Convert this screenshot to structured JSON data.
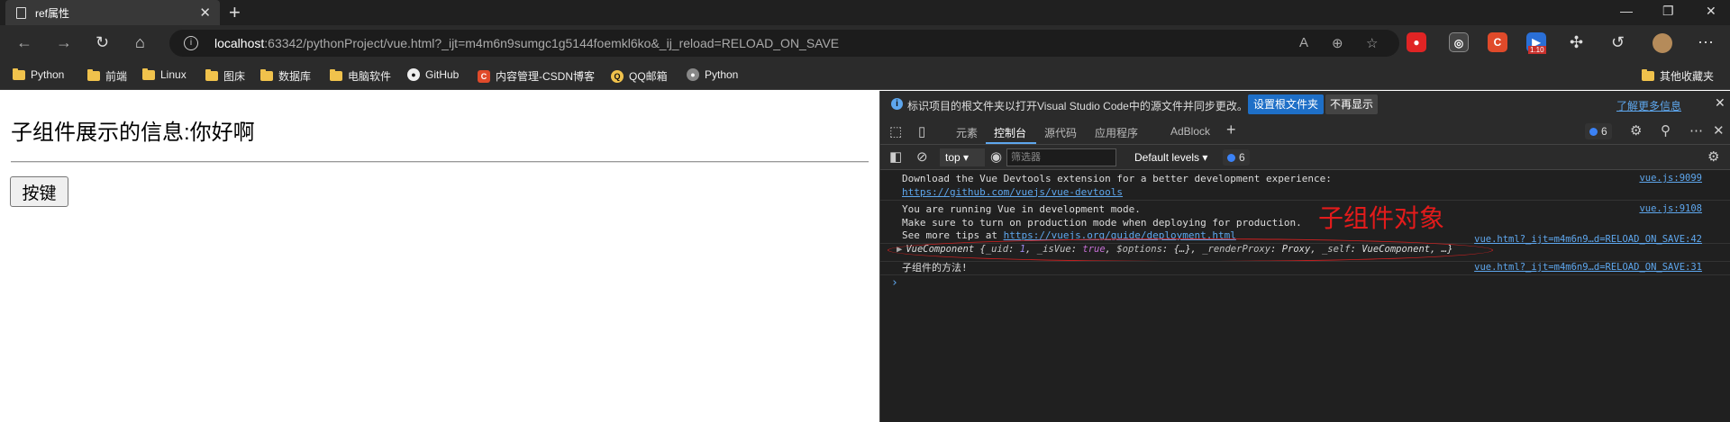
{
  "browser": {
    "tab_title": "ref属性",
    "new_tab": "+",
    "win_minimize": "—",
    "win_restore": "❐",
    "win_close": "✕",
    "url_host": "localhost",
    "url_rest": ":63342/pythonProject/vue.html?_ijt=m4m6n9sumgc1g5144foemkl6ko&_ij_reload=RELOAD_ON_SAVE",
    "ext_badge_count": "1.10",
    "bookmarks": [
      {
        "label": "Python",
        "icon": "folder"
      },
      {
        "label": "前端",
        "icon": "folder"
      },
      {
        "label": "Linux",
        "icon": "folder"
      },
      {
        "label": "图床",
        "icon": "folder"
      },
      {
        "label": "数据库",
        "icon": "folder"
      },
      {
        "label": "电脑软件",
        "icon": "folder"
      },
      {
        "label": "GitHub",
        "icon": "github-icon"
      },
      {
        "label": "内容管理-CSDN博客",
        "icon": "csdn-icon"
      },
      {
        "label": "QQ邮箱",
        "icon": "qq-mail-icon"
      },
      {
        "label": "Python",
        "icon": "python-icon"
      }
    ],
    "other_bookmarks": "其他收藏夹"
  },
  "page": {
    "child_message": "子组件展示的信息:你好啊",
    "button_label": "按键"
  },
  "devtools": {
    "info_text": "标识项目的根文件夹以打开Visual Studio Code中的源文件并同步更改。",
    "set_root_button": "设置根文件夹",
    "dont_show_button": "不再显示",
    "learn_more": "了解更多信息",
    "tabs": [
      "元素",
      "控制台",
      "源代码",
      "应用程序",
      "AdBlock"
    ],
    "active_tab": "控制台",
    "issues_count": "6",
    "context": "top",
    "filter_placeholder": "筛选器",
    "levels": "Default levels",
    "levels_count": "6",
    "console": {
      "msg1_line1": "Download the Vue Devtools extension for a better development experience:",
      "msg1_link": "https://github.com/vuejs/vue-devtools",
      "msg1_src": "vue.js:9099",
      "msg2_line1": "You are running Vue in development mode.",
      "msg2_line2": "Make sure to turn on production mode when deploying for production.",
      "msg2_line3_prefix": "See more tips at ",
      "msg2_link": "https://vuejs.org/guide/deployment.html",
      "msg2_src": "vue.js:9108",
      "msg3_src": "vue.html?_ijt=m4m6n9…d=RELOAD_ON_SAVE:42",
      "vc_prefix": "VueComponent {",
      "vc_uid_key": "_uid",
      "vc_uid_val": "1",
      "vc_isvue_key": "_isVue",
      "vc_isvue_val": "true",
      "vc_options_key": "$options",
      "vc_options_val": "{…}",
      "vc_proxy_key": "_renderProxy",
      "vc_proxy_val": "Proxy",
      "vc_self_key": "_self",
      "vc_self_val": "VueComponent",
      "vc_suffix": "…}",
      "msg4_text": "子组件的方法!",
      "msg4_src": "vue.html?_ijt=m4m6n9…d=RELOAD_ON_SAVE:31",
      "prompt": "›"
    },
    "annotation": "子组件对象"
  },
  "colors": {
    "accent": "#1e6fc7",
    "link": "#5ea7ee",
    "annotation_red": "#e31b1b"
  }
}
